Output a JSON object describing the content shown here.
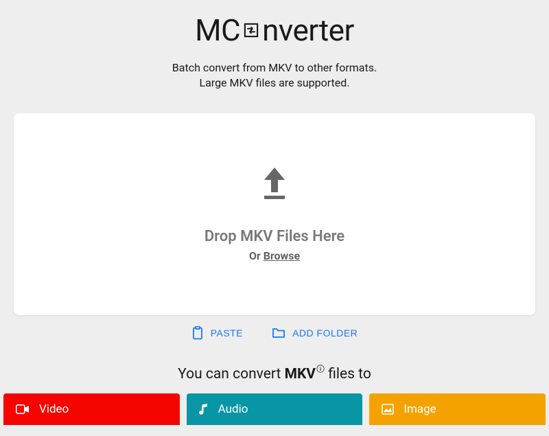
{
  "header": {
    "logo_left": "MC",
    "logo_right": "nverter",
    "tagline_line1": "Batch convert from MKV to other formats.",
    "tagline_line2": "Large MKV files are supported."
  },
  "dropzone": {
    "drop_text": "Drop MKV Files Here",
    "or_text": "Or ",
    "browse_text": "Browse"
  },
  "actions": {
    "paste_label": "PASTE",
    "add_folder_label": "ADD FOLDER"
  },
  "convert_heading": {
    "prefix": "You can convert ",
    "format": "MKV",
    "suffix": " files to"
  },
  "tabs": {
    "video": "Video",
    "audio": "Audio",
    "image": "Image"
  },
  "colors": {
    "video": "#f50500",
    "audio": "#0895a5",
    "image": "#f4a200",
    "link_blue": "#1976f5"
  }
}
